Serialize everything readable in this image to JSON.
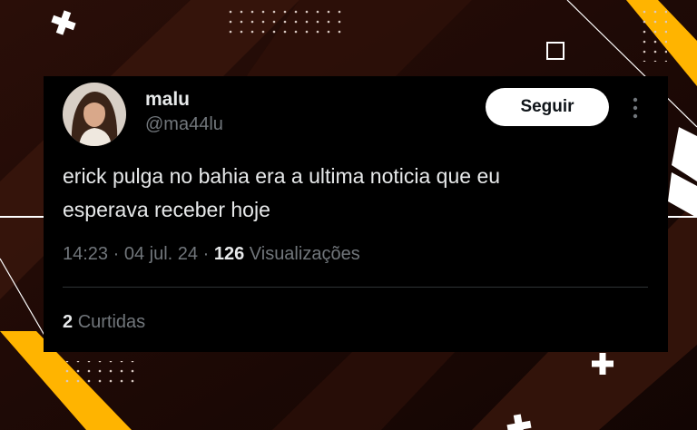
{
  "tweet": {
    "author_name": "malu",
    "author_handle": "@ma44lu",
    "follow_label": "Seguir",
    "text_line1": "erick pulga no bahia era a ultima noticia que eu",
    "text_line2": "esperava receber hoje",
    "time": "14:23",
    "date": "04 jul. 24",
    "views_count": "126",
    "views_label": "Visualizações",
    "likes_count": "2",
    "likes_label": "Curtidas",
    "separator": "·"
  },
  "colors": {
    "background_dark": "#1a0906",
    "accent_yellow": "#ffb400",
    "card": "#000000",
    "text_primary": "#e7e9ea",
    "text_secondary": "#71767b",
    "follow_bg": "#ffffff"
  },
  "icons": [
    "plus-icon",
    "square-outline-icon",
    "more-options-icon",
    "dot-grid-icon"
  ]
}
